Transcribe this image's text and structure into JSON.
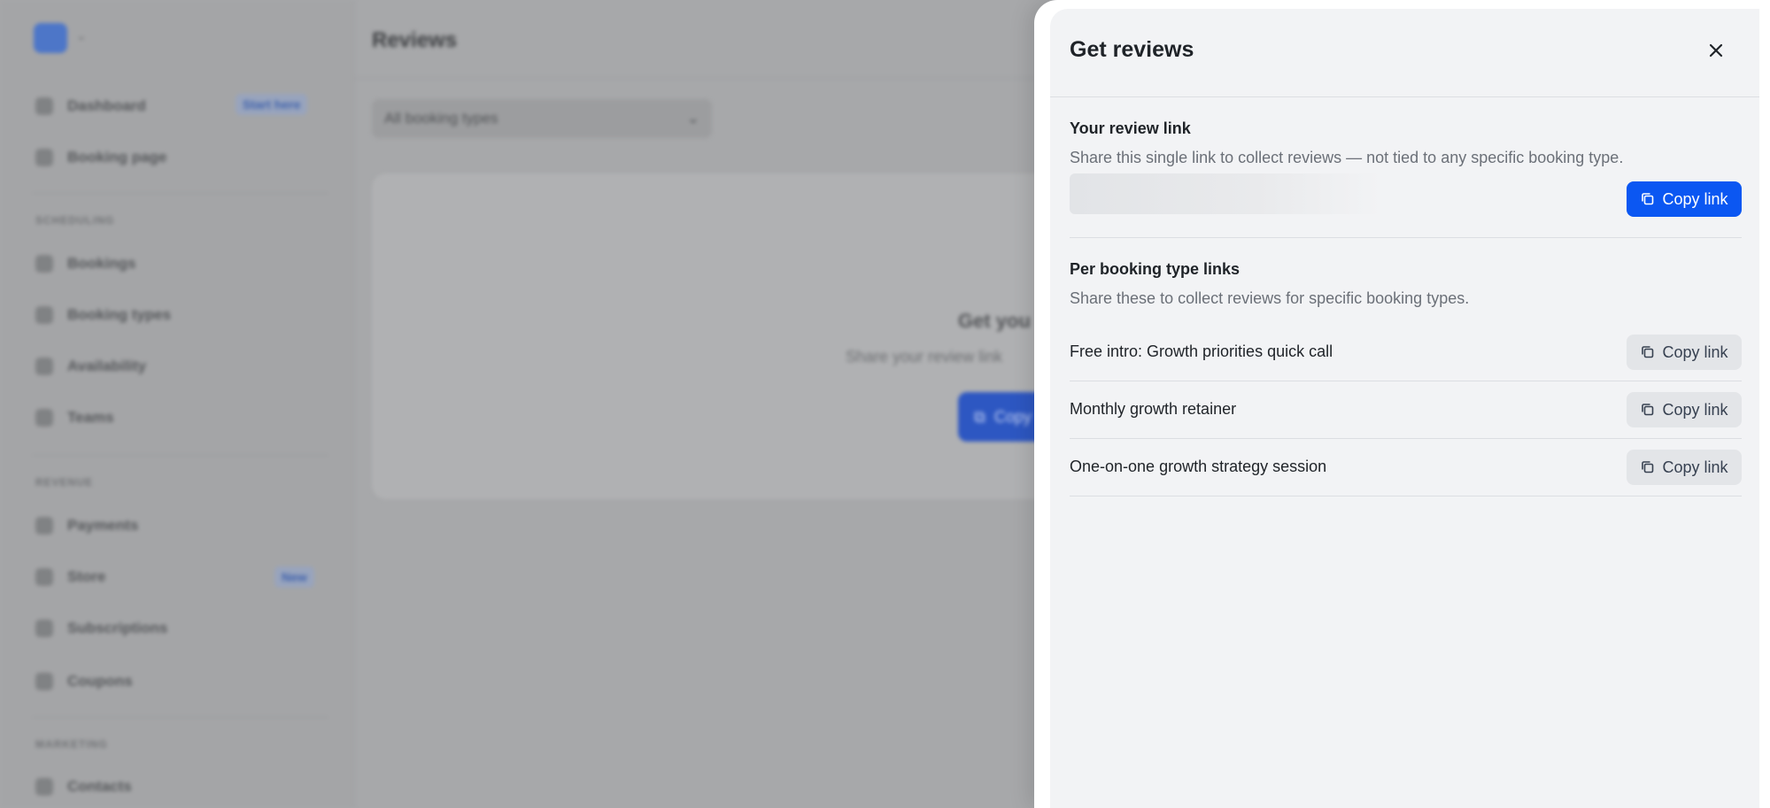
{
  "sidebar": {
    "items": [
      {
        "label": "Dashboard",
        "badge": "Start here"
      },
      {
        "label": "Booking page"
      },
      {
        "label": "Bookings"
      },
      {
        "label": "Booking types"
      },
      {
        "label": "Availability"
      },
      {
        "label": "Teams"
      },
      {
        "label": "Payments"
      },
      {
        "label": "Store",
        "badge": "New"
      },
      {
        "label": "Subscriptions"
      },
      {
        "label": "Coupons"
      },
      {
        "label": "Contacts"
      }
    ],
    "sections": [
      "SCHEDULING",
      "REVENUE",
      "MARKETING"
    ]
  },
  "main": {
    "title": "Reviews",
    "filter_value": "All booking types",
    "empty_title": "Get you",
    "empty_subtitle": "Share your review link",
    "empty_button": "Copy"
  },
  "drawer": {
    "title": "Get reviews",
    "review_link": {
      "title": "Your review link",
      "description": "Share this single link to collect reviews — not tied to any specific booking type.",
      "button_label": "Copy link"
    },
    "per_type": {
      "title": "Per booking type links",
      "description": "Share these to collect reviews for specific booking types.",
      "rows": [
        {
          "name": "Free intro: Growth priorities quick call",
          "button_label": "Copy link"
        },
        {
          "name": "Monthly growth retainer",
          "button_label": "Copy link"
        },
        {
          "name": "One-on-one growth strategy session",
          "button_label": "Copy link"
        }
      ]
    }
  },
  "colors": {
    "primary": "#0b57f2",
    "drawer_bg": "#f2f3f5",
    "secondary_button": "#e3e5e8"
  },
  "icons": {
    "close": "close-icon",
    "copy": "copy-icon",
    "logo": "calendar-logo-icon"
  }
}
